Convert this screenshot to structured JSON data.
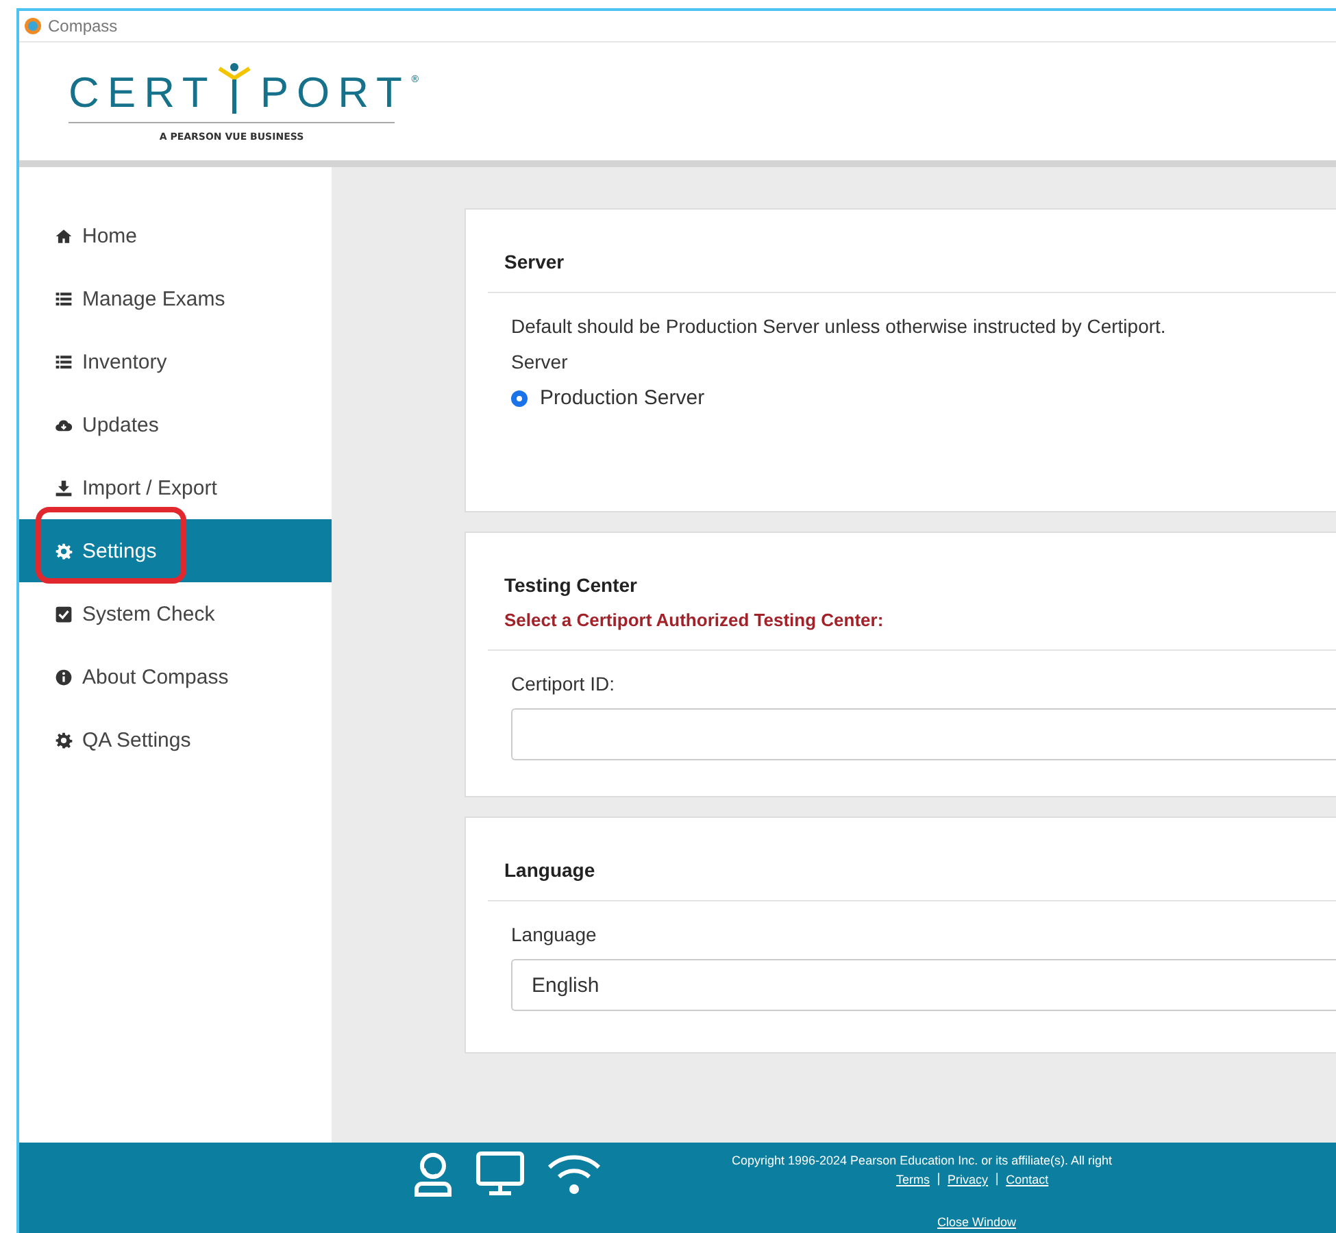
{
  "window": {
    "title": "Compass"
  },
  "logo": {
    "left": "CERT",
    "right": "PORT",
    "mark": "®",
    "tagline": "A PEARSON VUE BUSINESS"
  },
  "sidebar": {
    "items": [
      {
        "label": "Home",
        "selected": false,
        "highlighted": false
      },
      {
        "label": "Manage Exams",
        "selected": false,
        "highlighted": false
      },
      {
        "label": "Inventory",
        "selected": false,
        "highlighted": false
      },
      {
        "label": "Updates",
        "selected": false,
        "highlighted": false
      },
      {
        "label": "Import / Export",
        "selected": false,
        "highlighted": false
      },
      {
        "label": "Settings",
        "selected": true,
        "highlighted": true
      },
      {
        "label": "System Check",
        "selected": false,
        "highlighted": false
      },
      {
        "label": "About Compass",
        "selected": false,
        "highlighted": false
      },
      {
        "label": "QA Settings",
        "selected": false,
        "highlighted": false
      }
    ]
  },
  "sections": [
    {
      "kind": "radio",
      "title": "Server",
      "note": "Default should be Production Server unless otherwise instructed by Certiport.",
      "field_label": "Server",
      "options": [
        {
          "label": "Production Server",
          "selected": true
        }
      ]
    },
    {
      "kind": "input",
      "title": "Testing Center",
      "warning": "Select a Certiport Authorized Testing Center:",
      "field_label": "Certiport ID:"
    },
    {
      "kind": "select",
      "title": "Language",
      "field_label": "Language",
      "value": "English"
    }
  ],
  "footer": {
    "copyright": "Copyright 1996-2024 Pearson Education Inc. or its affiliate(s). All right",
    "links": [
      "Terms",
      "Privacy",
      "Contact"
    ],
    "separator": "|",
    "close": "Close Window"
  }
}
